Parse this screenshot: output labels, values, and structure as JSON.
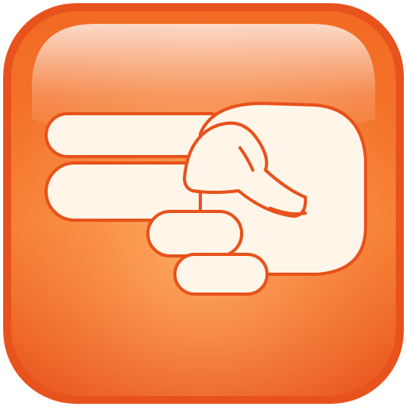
{
  "icon": {
    "semantic": "scissors-hand-gesture-icon",
    "colors": {
      "edge": "#e8521c",
      "body": "#f26a24",
      "highlight": "#ffb36a",
      "glass_top": "#ffffff",
      "hand_fill": "#fff6e9",
      "hand_stroke": "#e8521c"
    }
  }
}
